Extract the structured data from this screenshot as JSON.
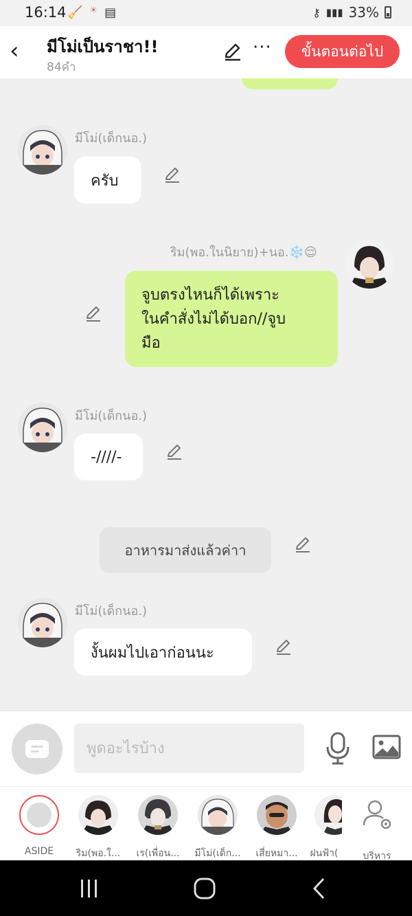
{
  "status_bar": {
    "time": "16:14",
    "battery": "33%"
  },
  "header": {
    "title": "มีโม่เป็นราชา!!",
    "subtitle": "84คำ",
    "next_button": "ขั้นตอนต่อไป",
    "more": "···"
  },
  "messages": [
    {
      "sender": "มีโม่(เด็กนอ.)",
      "text": "ครับ"
    },
    {
      "sender": "ริม(พอ.ในนิยาย)+นอ.❄️😌",
      "text": "จูบตรงไหนก็ได้เพราะ\nในคำสั่งไม่ได้บอก//จูบ\nมือ"
    },
    {
      "sender": "มีโม่(เด็กนอ.)",
      "text": "-////-"
    },
    {
      "text": "อาหารมาส่งแล้วค่าา"
    },
    {
      "sender": "มีโม่(เด็กนอ.)",
      "text": "งั้นผมไปเอาก่อนนะ"
    }
  ],
  "input": {
    "placeholder": "พูดอะไรบ้าง"
  },
  "characters": [
    {
      "label": "ASIDE"
    },
    {
      "label": "ริม(พอ.ใ..."
    },
    {
      "label": "เร(เพื่อน..."
    },
    {
      "label": "มีโม่(เด็ก..."
    },
    {
      "label": "เสี่ยหมา..."
    },
    {
      "label": "ฝนฟ้า("
    },
    {
      "label": "บริหาร"
    }
  ],
  "colors": {
    "accent": "#f04c50",
    "bubble_green": "#d6f594",
    "background": "#f0f0f0"
  }
}
